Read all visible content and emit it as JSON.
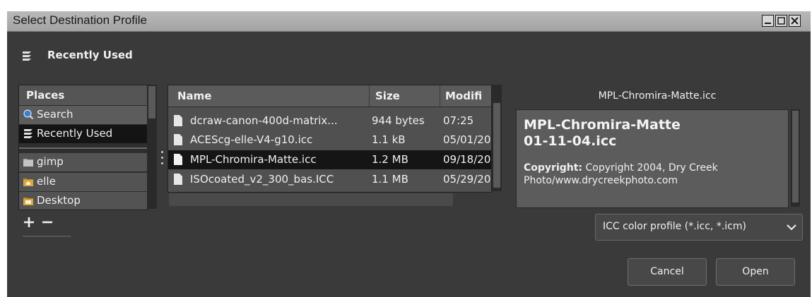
{
  "window": {
    "title": "Select Destination Profile",
    "controls": {
      "minimize": "_",
      "maximize": "□",
      "close": "X"
    }
  },
  "location": {
    "icon": "recent-stack-icon",
    "label": "Recently Used"
  },
  "places": {
    "header": "Places",
    "items": [
      {
        "label": "Search",
        "icon": "search-icon"
      },
      {
        "label": "Recently Used",
        "icon": "recent-stack-icon",
        "selected": true
      },
      {
        "label": "gimp",
        "icon": "folder-icon"
      },
      {
        "label": "elle",
        "icon": "home-folder-icon"
      },
      {
        "label": "Desktop",
        "icon": "desktop-folder-icon"
      }
    ],
    "add_label": "+",
    "remove_label": "−"
  },
  "files": {
    "columns": {
      "name": "Name",
      "size": "Size",
      "modified": "Modifi"
    },
    "rows": [
      {
        "name": "dcraw-canon-400d-matrix...",
        "size": "944 bytes",
        "modified": "07:25"
      },
      {
        "name": "ACEScg-elle-V4-g10.icc",
        "size": "1.1 kB",
        "modified": "05/01/20"
      },
      {
        "name": "MPL-Chromira-Matte.icc",
        "size": "1.2 MB",
        "modified": "09/18/20",
        "selected": true
      },
      {
        "name": "ISOcoated_v2_300_bas.ICC",
        "size": "1.1 MB",
        "modified": "05/29/20"
      }
    ]
  },
  "preview": {
    "title": "MPL-Chromira-Matte.icc",
    "name_line1": "MPL-Chromira-Matte",
    "name_line2": "01-11-04.icc",
    "copyright_label": "Copyright:",
    "copyright_text": "Copyright 2004, Dry Creek Photo/www.drycreekphoto.com"
  },
  "filter": {
    "selected": "ICC color profile (*.icc, *.icm)"
  },
  "buttons": {
    "cancel": "Cancel",
    "open": "Open"
  },
  "colors": {
    "window_bg": "#3a3a3a",
    "selection": "#151515",
    "title_bar": "#b0b0b0"
  }
}
